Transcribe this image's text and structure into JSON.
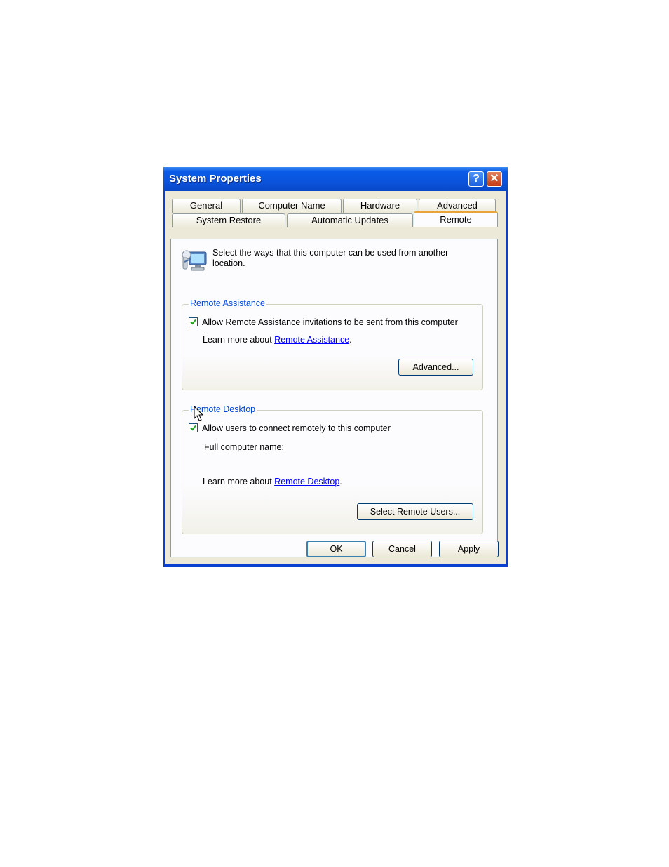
{
  "window": {
    "title": "System Properties",
    "help_label": "?",
    "close_label": "✕"
  },
  "tabs": {
    "row1": [
      "General",
      "Computer Name",
      "Hardware",
      "Advanced"
    ],
    "row2": [
      "System Restore",
      "Automatic Updates",
      "Remote"
    ],
    "active": "Remote"
  },
  "intro": "Select the ways that this computer can be used from another location.",
  "icon_name": "remote-computer-icon",
  "remote_assistance": {
    "group_label": "Remote Assistance",
    "checkbox_label": "Allow Remote Assistance invitations to be sent from this computer",
    "checked": true,
    "learn_prefix": "Learn more about",
    "learn_link": "Remote Assistance",
    "learn_suffix": ".",
    "advanced_button": "Advanced..."
  },
  "remote_desktop": {
    "group_label": "Remote Desktop",
    "checkbox_label": "Allow users to connect remotely to this computer",
    "checked": true,
    "full_name_label": "Full computer name:",
    "full_name_value": "",
    "learn_prefix": "Learn more about",
    "learn_link": "Remote Desktop",
    "learn_suffix": ".",
    "select_users_button": "Select Remote Users..."
  },
  "footer": {
    "ok": "OK",
    "cancel": "Cancel",
    "apply": "Apply"
  },
  "colors": {
    "title_bar": "#0a54dc",
    "dialog_bg": "#ece9d8",
    "group_label": "#0046d5",
    "link": "#0000ff",
    "active_tab_accent": "#e8a33b"
  }
}
